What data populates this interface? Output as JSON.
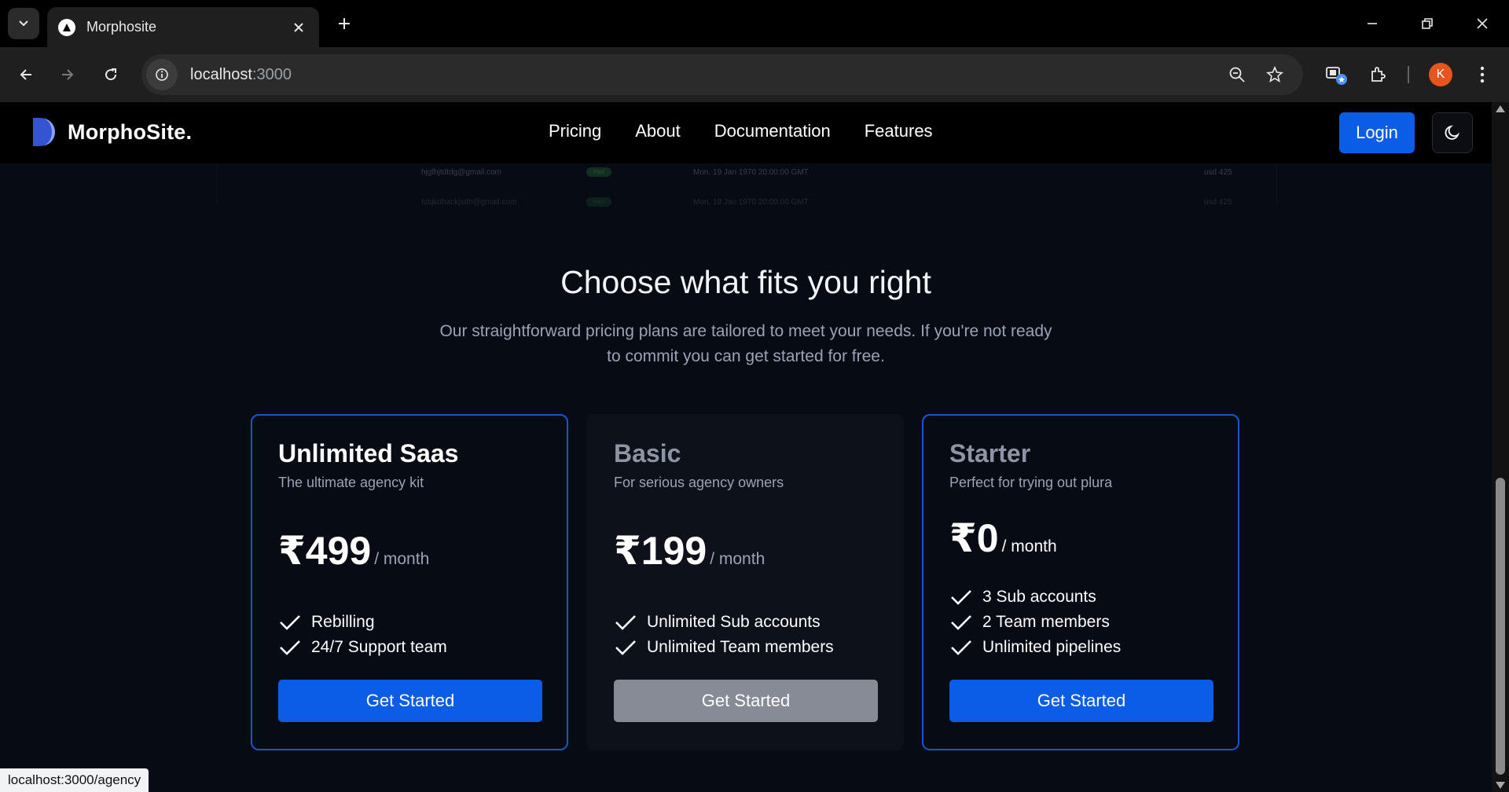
{
  "browser": {
    "tab_title": "Morphosite",
    "url_host": "localhost",
    "url_port": ":3000",
    "avatar_initial": "K",
    "status_url": "localhost:3000/agency"
  },
  "header": {
    "logo_text": "MorphoSite.",
    "nav": [
      "Pricing",
      "About",
      "Documentation",
      "Features"
    ],
    "login_label": "Login"
  },
  "preview_rows": [
    {
      "email": "hjgfhjtdtdg@gmail.com",
      "status": "Paid",
      "date": "Mon, 19 Jan 1970 20:00:00 GMT",
      "amount": "usd 425"
    },
    {
      "email": "fdsjkdhackjsdh@gmail.com",
      "status": "Paid",
      "date": "Mon, 19 Jan 1970 20:00:00 GMT",
      "amount": "usd 425"
    }
  ],
  "hero": {
    "title": "Choose what fits you right",
    "subtitle": "Our straightforward pricing plans are tailored to meet your needs. If you're not ready to commit you can get started for free."
  },
  "plans": [
    {
      "title": "Unlimited Saas",
      "description": "The ultimate agency kit",
      "price": "₹499",
      "period": "/ month",
      "features": [
        "Rebilling",
        "24/7 Support team"
      ],
      "cta": "Get Started"
    },
    {
      "title": "Basic",
      "description": "For serious agency owners",
      "price": "₹199",
      "period": "/ month",
      "features": [
        "Unlimited Sub accounts",
        "Unlimited Team members"
      ],
      "cta": "Get Started"
    },
    {
      "title": "Starter",
      "description": "Perfect for trying out plura",
      "price": "₹0",
      "period": "/ month",
      "features": [
        "3 Sub accounts",
        "2 Team members",
        "Unlimited pipelines"
      ],
      "cta": "Get Started"
    }
  ],
  "colors": {
    "accent": "#0b5ce6",
    "card_border": "#1954cf",
    "page_bg": "#070b14",
    "muted_button": "#868b96"
  }
}
